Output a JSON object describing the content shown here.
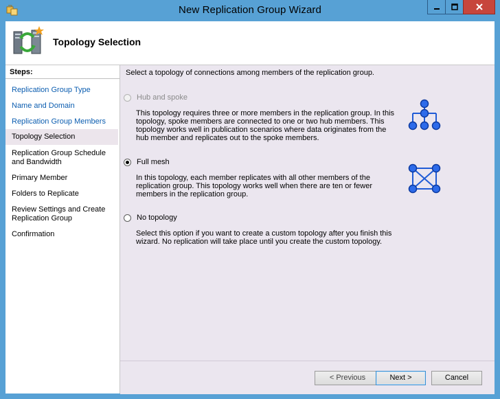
{
  "window": {
    "title": "New Replication Group Wizard"
  },
  "header": {
    "title": "Topology Selection"
  },
  "steps": {
    "heading": "Steps:",
    "items": [
      {
        "label": "Replication Group Type"
      },
      {
        "label": "Name and Domain"
      },
      {
        "label": "Replication Group Members"
      },
      {
        "label": "Topology Selection"
      },
      {
        "label": "Replication Group Schedule and Bandwidth"
      },
      {
        "label": "Primary Member"
      },
      {
        "label": "Folders to Replicate"
      },
      {
        "label": "Review Settings and Create Replication Group"
      },
      {
        "label": "Confirmation"
      }
    ]
  },
  "content": {
    "instruction": "Select a topology of connections among members of the replication group.",
    "options": [
      {
        "label": "Hub and spoke",
        "enabled": false,
        "selected": false,
        "icon": "hub-and-spoke-icon",
        "description": "This topology requires three or more members in the replication group. In this topology, spoke members are connected to one or two hub members. This topology works well in publication scenarios where data originates from the hub member and replicates out to the spoke members."
      },
      {
        "label": "Full mesh",
        "enabled": true,
        "selected": true,
        "icon": "full-mesh-icon",
        "description": "In this topology, each member replicates with all other members of the replication group. This topology works well when there are ten or fewer members in the replication group."
      },
      {
        "label": "No topology",
        "enabled": true,
        "selected": false,
        "icon": null,
        "description": "Select this option if you want to create a custom topology after you finish this wizard. No replication will take place until you create the custom topology."
      }
    ]
  },
  "buttons": {
    "previous": "< Previous",
    "next": "Next >",
    "cancel": "Cancel"
  },
  "colors": {
    "titlebar": "#57a1d5",
    "close_button": "#c7463c",
    "link": "#0b5db0",
    "content_background": "#ebe6ef",
    "topology_icon": "#1f5bd6"
  }
}
